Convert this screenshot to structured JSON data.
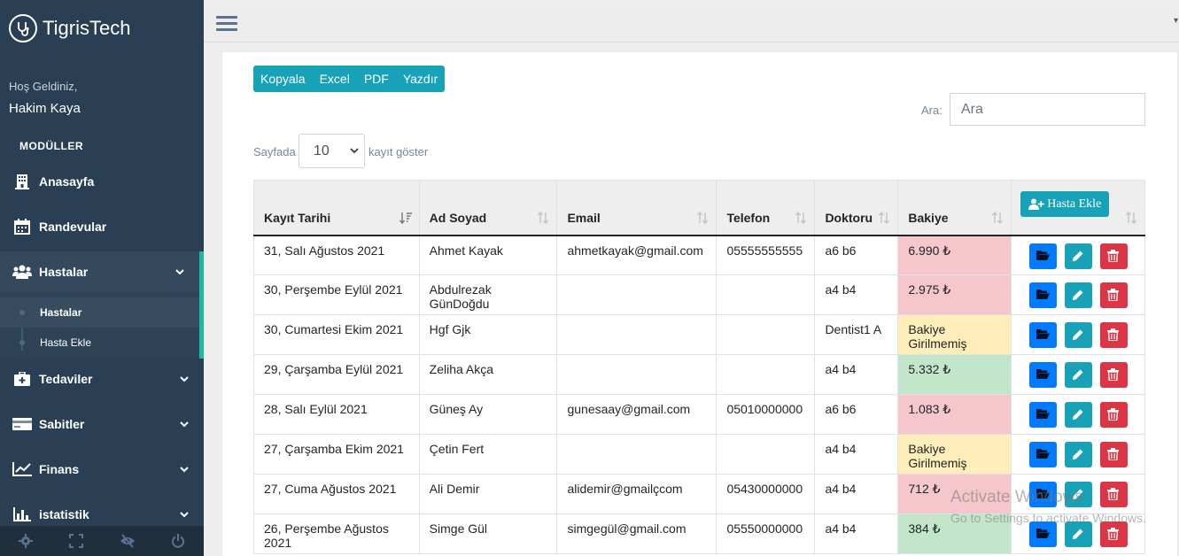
{
  "sidebar": {
    "brand": "TigrisTech",
    "welcome": "Hoş Geldiniz,",
    "user_name": "Hakim Kaya",
    "modules_title": "MODÜLLER",
    "items": [
      {
        "label": "Anasayfa",
        "icon": "building-icon"
      },
      {
        "label": "Randevular",
        "icon": "calendar-icon"
      },
      {
        "label": "Hastalar",
        "icon": "users-icon"
      },
      {
        "label": "Tedaviler",
        "icon": "medkit-icon"
      },
      {
        "label": "Sabitler",
        "icon": "credit-card-icon"
      },
      {
        "label": "Finans",
        "icon": "chart-line-icon"
      },
      {
        "label": "istatistik",
        "icon": "bar-chart-icon"
      }
    ],
    "submenu": [
      {
        "label": "Hastalar"
      },
      {
        "label": "Hasta Ekle"
      }
    ],
    "footer_icons": [
      "settings-icon",
      "fullscreen-icon",
      "eye-slash-icon",
      "power-icon"
    ]
  },
  "toolbar": {
    "buttons": [
      "Kopyala",
      "Excel",
      "PDF",
      "Yazdır"
    ]
  },
  "search": {
    "label": "Ara:",
    "placeholder": "Ara"
  },
  "length": {
    "prefix": "Sayfada",
    "value": "10",
    "suffix": "kayıt göster"
  },
  "table": {
    "columns": [
      "Kayıt Tarihi",
      "Ad Soyad",
      "Email",
      "Telefon",
      "Doktoru",
      "Bakiye"
    ],
    "add_button": "Hasta Ekle",
    "rows": [
      {
        "date": "31, Salı Ağustos 2021",
        "name": "Ahmet Kayak",
        "email": "ahmetkayak@gmail.com",
        "phone": "05555555555",
        "doctor": "a6 b6",
        "balance": "6.990 ₺",
        "status": "red"
      },
      {
        "date": "30, Perşembe Eylül 2021",
        "name": "Abdulrezak GünDoğdu",
        "email": "",
        "phone": "",
        "doctor": "a4 b4",
        "balance": "2.975 ₺",
        "status": "red"
      },
      {
        "date": "30, Cumartesi Ekim 2021",
        "name": "Hgf Gjk",
        "email": "",
        "phone": "",
        "doctor": "Dentist1 A",
        "balance": "Bakiye Girilmemiş",
        "status": "yellow"
      },
      {
        "date": "29, Çarşamba Eylül 2021",
        "name": "Zeliha Akça",
        "email": "",
        "phone": "",
        "doctor": "a4 b4",
        "balance": "5.332 ₺",
        "status": "green"
      },
      {
        "date": "28, Salı Eylül 2021",
        "name": "Güneş Ay",
        "email": "gunesaay@gmail.com",
        "phone": "05010000000",
        "doctor": "a6 b6",
        "balance": "1.083 ₺",
        "status": "red"
      },
      {
        "date": "27, Çarşamba Ekim 2021",
        "name": "Çetin Fert",
        "email": "",
        "phone": "",
        "doctor": "a4 b4",
        "balance": "Bakiye Girilmemiş",
        "status": "yellow"
      },
      {
        "date": "27, Cuma Ağustos 2021",
        "name": "Ali Demir",
        "email": "alidemir@gmailçcom",
        "phone": "05430000000",
        "doctor": "a4 b4",
        "balance": "712 ₺",
        "status": "red"
      },
      {
        "date": "26, Perşembe Ağustos 2021",
        "name": "Simge Gül",
        "email": "simgegül@gmail.com",
        "phone": "05550000000",
        "doctor": "a4 b4",
        "balance": "384 ₺",
        "status": "green"
      }
    ]
  },
  "watermark": {
    "title": "Activate Windows",
    "subtitle": "Go to Settings to activate Windows."
  },
  "colors": {
    "sidebar": "#2a3f54",
    "accent": "#1abb9c",
    "info": "#17a2b8",
    "primary": "#007bff",
    "danger": "#dc3545",
    "balance_red": "#f5c6cb",
    "balance_yellow": "#ffeeba",
    "balance_green": "#c3e6cb"
  }
}
